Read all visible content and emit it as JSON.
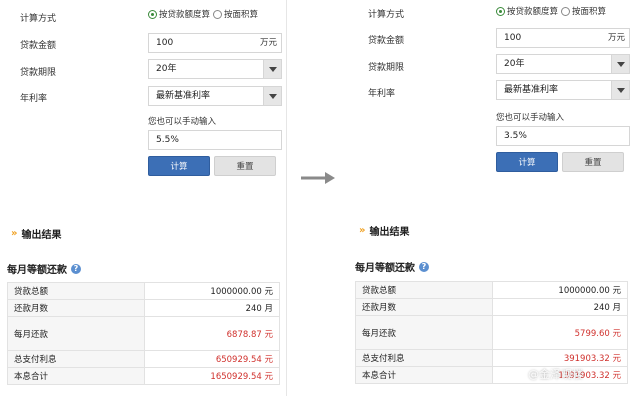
{
  "left": {
    "calc_method_label": "计算方式",
    "calc_options": [
      "按贷款额度算",
      "按面积算"
    ],
    "loan_amount_label": "贷款金额",
    "loan_amount_value": "100",
    "loan_amount_unit": "万元",
    "loan_term_label": "贷款期限",
    "loan_term_value": "20年",
    "rate_label": "年利率",
    "rate_select_value": "最新基准利率",
    "manual_hint": "您也可以手动输入",
    "manual_rate_value": "5.5%",
    "calc_button": "计算",
    "reset_button": "重置",
    "output_title": "输出结果",
    "monthly_title": "每月等额还款",
    "results": [
      {
        "label": "贷款总额",
        "value": "1000000.00 元"
      },
      {
        "label": "还款月数",
        "value": "240 月"
      },
      {
        "label": "每月还款",
        "value": "6878.87 元"
      },
      {
        "label": "总支付利息",
        "value": "650929.54 元"
      },
      {
        "label": "本息合计",
        "value": "1650929.54 元"
      }
    ]
  },
  "right": {
    "calc_method_label": "计算方式",
    "calc_options": [
      "按贷款额度算",
      "按面积算"
    ],
    "loan_amount_label": "贷款金额",
    "loan_amount_value": "100",
    "loan_amount_unit": "万元",
    "loan_term_label": "贷款期限",
    "loan_term_value": "20年",
    "rate_label": "年利率",
    "rate_select_value": "最新基准利率",
    "manual_hint": "您也可以手动输入",
    "manual_rate_value": "3.5%",
    "calc_button": "计算",
    "reset_button": "重置",
    "output_title": "输出结果",
    "monthly_title": "每月等额还款",
    "results": [
      {
        "label": "贷款总额",
        "value": "1000000.00 元"
      },
      {
        "label": "还款月数",
        "value": "240 月"
      },
      {
        "label": "每月还款",
        "value": "5799.60 元"
      },
      {
        "label": "总支付利息",
        "value": "391903.32 元"
      },
      {
        "label": "本息合计",
        "value": "1391903.32 元"
      }
    ]
  },
  "watermark": "@金泽观楼",
  "colors": {
    "button_blue": "#3c6fb6",
    "highlight_red": "#d0312d",
    "radio_green": "#3a8a3a",
    "arrow_orange": "#f0a020",
    "help_icon_blue": "#5b8fd0"
  }
}
